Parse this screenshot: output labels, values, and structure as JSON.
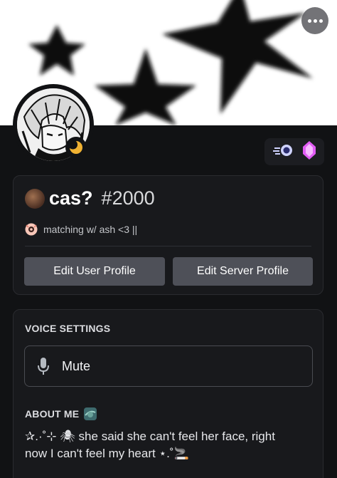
{
  "banner": {
    "more_icon": "more-horizontal-icon"
  },
  "avatar": {
    "status_icon": "idle-moon-icon",
    "status_color": "#f0b232"
  },
  "badges": [
    {
      "icon": "nitro-badge-icon"
    },
    {
      "icon": "boost-gem-icon",
      "color": "#e25cf5"
    }
  ],
  "profile": {
    "display_name": "cas?",
    "discriminator": "#2000",
    "custom_status": "matching w/ ash <3 ||",
    "status_icon": "emoji-status-icon"
  },
  "actions": {
    "edit_user_profile": "Edit User Profile",
    "edit_server_profile": "Edit Server Profile"
  },
  "voice_settings": {
    "title": "VOICE SETTINGS",
    "mute_label": "Mute",
    "mute_icon": "microphone-icon"
  },
  "about_me": {
    "title": "ABOUT ME",
    "title_icon": "planet-emoji-icon",
    "line1": "✰.·˚⊹ 🕷 she said she can't feel her face, right",
    "line2": "now I can't feel my heart ⋆.˚🚬"
  },
  "colors": {
    "background": "#111214",
    "card": "#18191c",
    "button": "#4e5058",
    "banner": "#ffffff"
  }
}
